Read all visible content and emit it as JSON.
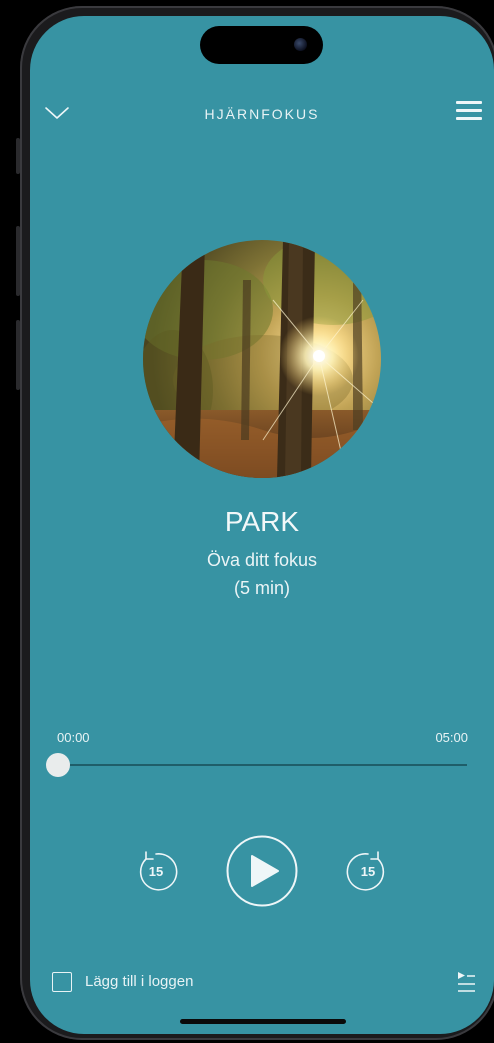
{
  "header": {
    "title": "HJÄRNFOKUS",
    "collapse_icon": "chevron-down-icon",
    "menu_icon": "hamburger-menu-icon"
  },
  "track": {
    "title": "PARK",
    "subtitle": "Öva ditt fokus",
    "duration_label": "(5 min)",
    "artwork": "forest-sunlight-image"
  },
  "player": {
    "elapsed": "00:00",
    "total": "05:00",
    "progress": 0,
    "skip_back_label": "15",
    "skip_forward_label": "15",
    "play_icon": "play-icon"
  },
  "footer": {
    "log_label": "Lägg till i loggen",
    "log_checked": false,
    "queue_icon": "playlist-icon"
  },
  "colors": {
    "screen_bg": "#3793a3",
    "text": "#e8f3f5",
    "track_line": "#1f5e69"
  }
}
